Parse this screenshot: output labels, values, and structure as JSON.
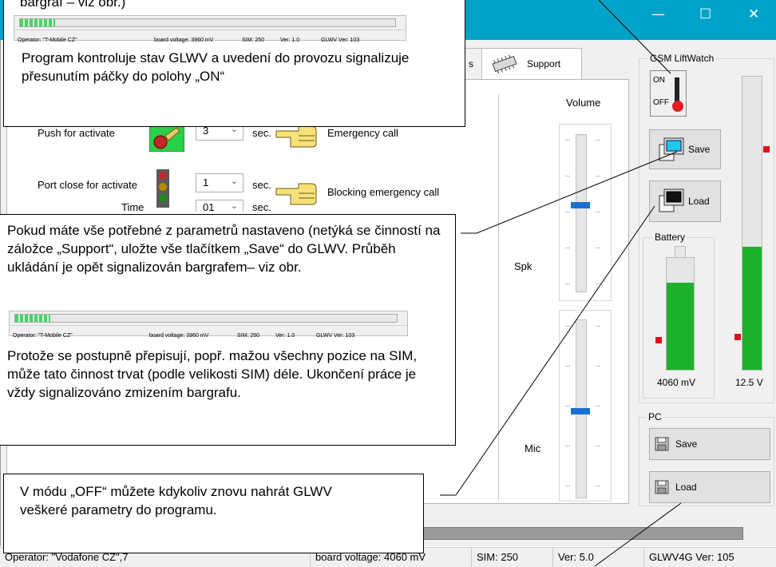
{
  "window": {
    "controls": {
      "minimize": "—",
      "maximize": "☐",
      "close": "✕"
    }
  },
  "tabs": [
    {
      "label": "s"
    },
    {
      "label": "Support"
    }
  ],
  "form": {
    "push_label": "Push for activate",
    "push_value": "3",
    "sec1": "sec.",
    "emergency_call": "Emergency call",
    "port_label": "Port close for activate",
    "port_value": "1",
    "sec2": "sec.",
    "blocking_call": "Blocking emergency call",
    "time_label": "Time",
    "time_value": "01",
    "sec3": "sec."
  },
  "volume": {
    "title": "Volume",
    "spk_label": "Spk",
    "mic_label": "Mic",
    "spk_level": 0.55,
    "mic_level": 0.48
  },
  "gsm": {
    "group_title": "GSM LiftWatch",
    "switch_on": "ON",
    "switch_off": "OFF",
    "save_label": "Save",
    "load_label": "Load",
    "battery_title": "Battery",
    "battery_value": "4060 mV",
    "battery_level": 0.78,
    "voltage_value": "12.5 V",
    "voltage_level": 0.42
  },
  "pc": {
    "group_title": "PC",
    "save_label": "Save",
    "load_label": "Load"
  },
  "progress": {
    "level": 0.08
  },
  "status": {
    "operator": "Operator: \"Vodafone CZ\",7",
    "board_voltage": "board voltage: 4060 mV",
    "sim": "SIM: 250",
    "ver": "Ver: 5.0",
    "glwv": "GLWV4G Ver: 105"
  },
  "mini_status": {
    "operator": "Operator: \"T-Mobile CZ\"",
    "board_voltage": "board voltage: 3960 mV",
    "sim": "SIM: 250",
    "ver": "Ver: 1.0",
    "glwv": "GLWV Ver: 103"
  },
  "callouts": {
    "top_heading": "bargraf – viz obr.)",
    "top_text": "Program kontroluje stav GLWV a uvedení do provozu signalizuje přesunutím páčky do polohy „ON“",
    "middle_text_1": "Pokud máte vše potřebné z parametrů nastaveno (netýká se činností na záložce „Support“, uložte vše tlačítkem „Save“ do GLWV. Průběh ukládání je opět signalizován bargrafem– viz obr.",
    "middle_text_2": "Protože se postupně přepisují, popř. mažou všechny pozice na SIM, může tato činnost trvat (podle velikosti SIM) déle. Ukončení práce je vždy signalizováno zmizením bargrafu.",
    "bottom_text": "V módu „OFF“ můžete kdykoliv znovu nahrát GLWV veškeré parametry do programu."
  },
  "colors": {
    "titlebar": "#00a2c7",
    "battery_fill": "#1db02a",
    "marker": "#e0101a",
    "progress_fill": "#33d6f0",
    "slider_thumb": "#1a6fd0"
  }
}
